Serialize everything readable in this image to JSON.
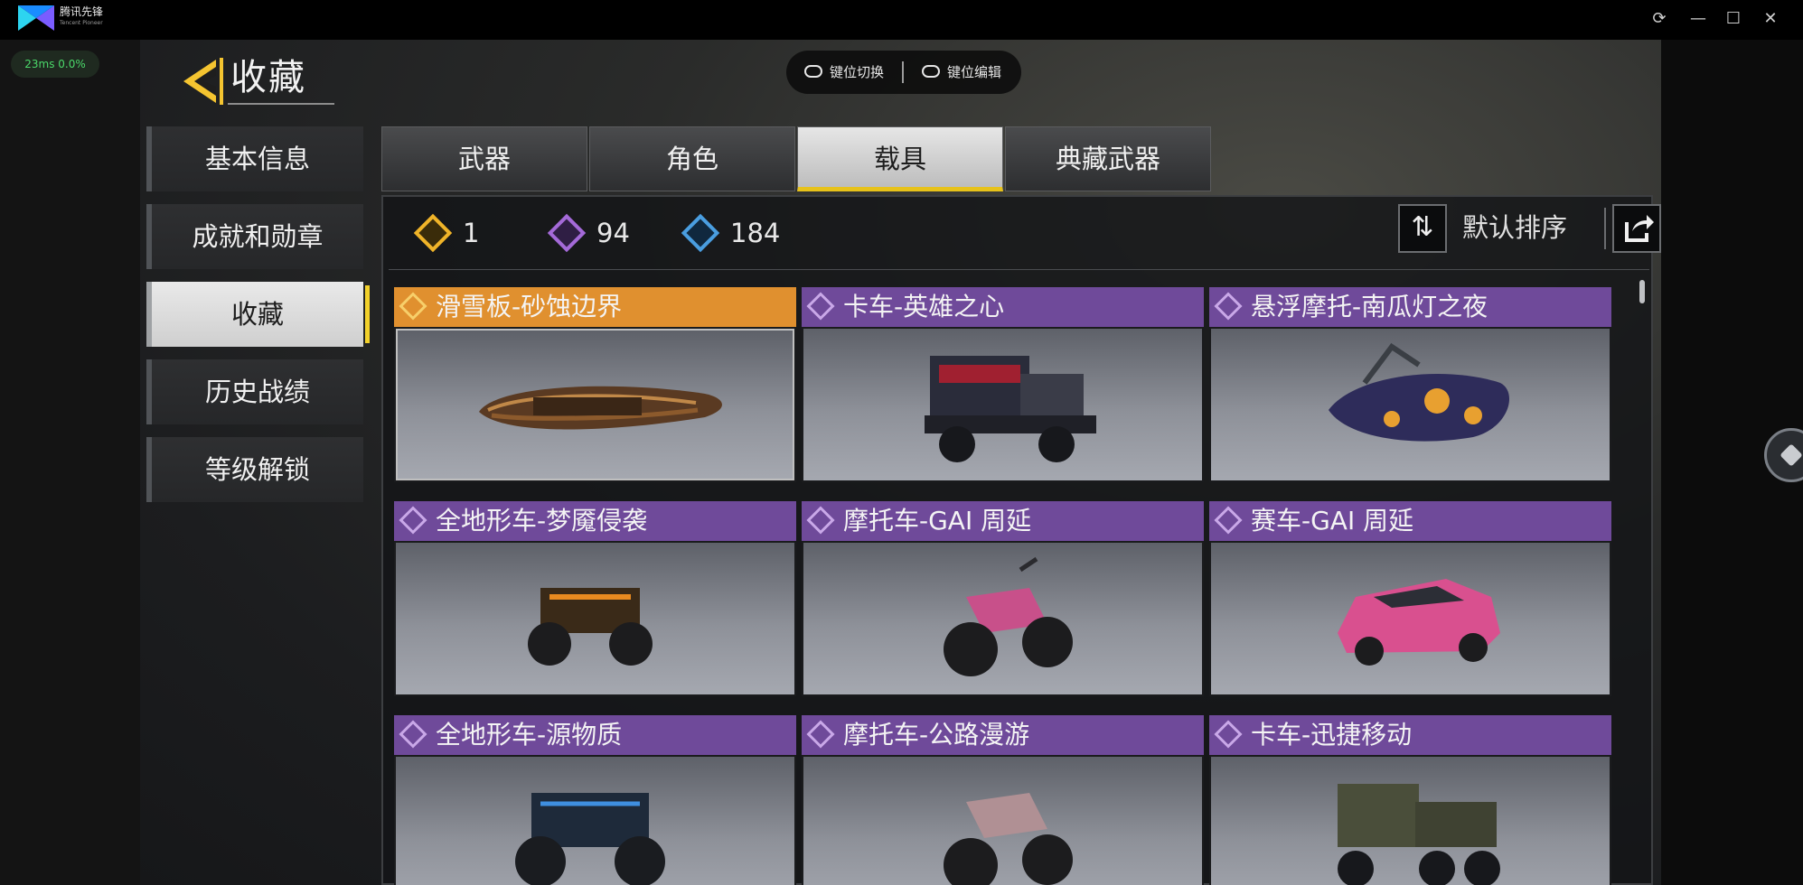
{
  "titlebar": {
    "app_name": "腾讯先锋",
    "app_sub": "Tencent Pioneer",
    "icons": [
      "refresh-icon",
      "minimize-icon",
      "maximize-icon",
      "close-icon"
    ]
  },
  "overlay": {
    "ping": "23ms  0.0%"
  },
  "header": {
    "title": "收藏",
    "key_switch": "键位切换",
    "key_edit": "键位编辑"
  },
  "sidebar": {
    "items": [
      {
        "label": "基本信息",
        "active": false
      },
      {
        "label": "成就和勋章",
        "active": false
      },
      {
        "label": "收藏",
        "active": true
      },
      {
        "label": "历史战绩",
        "active": false
      },
      {
        "label": "等级解锁",
        "active": false
      }
    ]
  },
  "tabs": [
    {
      "label": "武器",
      "active": false
    },
    {
      "label": "角色",
      "active": false
    },
    {
      "label": "载具",
      "active": true
    },
    {
      "label": "典藏武器",
      "active": false
    }
  ],
  "counts": [
    {
      "rarity": "legendary",
      "color": "#f0b429",
      "value": "1"
    },
    {
      "rarity": "epic",
      "color": "#a46ad8",
      "value": "94"
    },
    {
      "rarity": "rare",
      "color": "#4a9ee0",
      "value": "184"
    }
  ],
  "sort": {
    "label": "默认排序"
  },
  "colors": {
    "legendary_header": "#e0902f",
    "epic_header": "#6f4a9a",
    "tab_active_underline": "#e7c21a"
  },
  "items": [
    {
      "name": "滑雪板-砂蚀边界",
      "rarity": "legendary"
    },
    {
      "name": "卡车-英雄之心",
      "rarity": "epic"
    },
    {
      "name": "悬浮摩托-南瓜灯之夜",
      "rarity": "epic"
    },
    {
      "name": "全地形车-梦魇侵袭",
      "rarity": "epic"
    },
    {
      "name": "摩托车-GAI 周延",
      "rarity": "epic"
    },
    {
      "name": "赛车-GAI 周延",
      "rarity": "epic"
    },
    {
      "name": "全地形车-源物质",
      "rarity": "epic"
    },
    {
      "name": "摩托车-公路漫游",
      "rarity": "epic"
    },
    {
      "name": "卡车-迅捷移动",
      "rarity": "epic"
    }
  ]
}
